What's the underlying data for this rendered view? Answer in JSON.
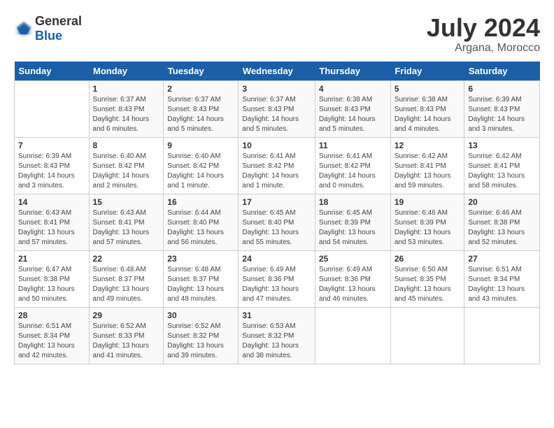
{
  "logo": {
    "text_general": "General",
    "text_blue": "Blue"
  },
  "title": {
    "month_year": "July 2024",
    "location": "Argana, Morocco"
  },
  "days_of_week": [
    "Sunday",
    "Monday",
    "Tuesday",
    "Wednesday",
    "Thursday",
    "Friday",
    "Saturday"
  ],
  "weeks": [
    [
      {
        "day": "",
        "sunrise": "",
        "sunset": "",
        "daylight": ""
      },
      {
        "day": "1",
        "sunrise": "Sunrise: 6:37 AM",
        "sunset": "Sunset: 8:43 PM",
        "daylight": "Daylight: 14 hours and 6 minutes."
      },
      {
        "day": "2",
        "sunrise": "Sunrise: 6:37 AM",
        "sunset": "Sunset: 8:43 PM",
        "daylight": "Daylight: 14 hours and 5 minutes."
      },
      {
        "day": "3",
        "sunrise": "Sunrise: 6:37 AM",
        "sunset": "Sunset: 8:43 PM",
        "daylight": "Daylight: 14 hours and 5 minutes."
      },
      {
        "day": "4",
        "sunrise": "Sunrise: 6:38 AM",
        "sunset": "Sunset: 8:43 PM",
        "daylight": "Daylight: 14 hours and 5 minutes."
      },
      {
        "day": "5",
        "sunrise": "Sunrise: 6:38 AM",
        "sunset": "Sunset: 8:43 PM",
        "daylight": "Daylight: 14 hours and 4 minutes."
      },
      {
        "day": "6",
        "sunrise": "Sunrise: 6:39 AM",
        "sunset": "Sunset: 8:43 PM",
        "daylight": "Daylight: 14 hours and 3 minutes."
      }
    ],
    [
      {
        "day": "7",
        "sunrise": "Sunrise: 6:39 AM",
        "sunset": "Sunset: 8:43 PM",
        "daylight": "Daylight: 14 hours and 3 minutes."
      },
      {
        "day": "8",
        "sunrise": "Sunrise: 6:40 AM",
        "sunset": "Sunset: 8:42 PM",
        "daylight": "Daylight: 14 hours and 2 minutes."
      },
      {
        "day": "9",
        "sunrise": "Sunrise: 6:40 AM",
        "sunset": "Sunset: 8:42 PM",
        "daylight": "Daylight: 14 hours and 1 minute."
      },
      {
        "day": "10",
        "sunrise": "Sunrise: 6:41 AM",
        "sunset": "Sunset: 8:42 PM",
        "daylight": "Daylight: 14 hours and 1 minute."
      },
      {
        "day": "11",
        "sunrise": "Sunrise: 6:41 AM",
        "sunset": "Sunset: 8:42 PM",
        "daylight": "Daylight: 14 hours and 0 minutes."
      },
      {
        "day": "12",
        "sunrise": "Sunrise: 6:42 AM",
        "sunset": "Sunset: 8:41 PM",
        "daylight": "Daylight: 13 hours and 59 minutes."
      },
      {
        "day": "13",
        "sunrise": "Sunrise: 6:42 AM",
        "sunset": "Sunset: 8:41 PM",
        "daylight": "Daylight: 13 hours and 58 minutes."
      }
    ],
    [
      {
        "day": "14",
        "sunrise": "Sunrise: 6:43 AM",
        "sunset": "Sunset: 8:41 PM",
        "daylight": "Daylight: 13 hours and 57 minutes."
      },
      {
        "day": "15",
        "sunrise": "Sunrise: 6:43 AM",
        "sunset": "Sunset: 8:41 PM",
        "daylight": "Daylight: 13 hours and 57 minutes."
      },
      {
        "day": "16",
        "sunrise": "Sunrise: 6:44 AM",
        "sunset": "Sunset: 8:40 PM",
        "daylight": "Daylight: 13 hours and 56 minutes."
      },
      {
        "day": "17",
        "sunrise": "Sunrise: 6:45 AM",
        "sunset": "Sunset: 8:40 PM",
        "daylight": "Daylight: 13 hours and 55 minutes."
      },
      {
        "day": "18",
        "sunrise": "Sunrise: 6:45 AM",
        "sunset": "Sunset: 8:39 PM",
        "daylight": "Daylight: 13 hours and 54 minutes."
      },
      {
        "day": "19",
        "sunrise": "Sunrise: 6:46 AM",
        "sunset": "Sunset: 8:39 PM",
        "daylight": "Daylight: 13 hours and 53 minutes."
      },
      {
        "day": "20",
        "sunrise": "Sunrise: 6:46 AM",
        "sunset": "Sunset: 8:38 PM",
        "daylight": "Daylight: 13 hours and 52 minutes."
      }
    ],
    [
      {
        "day": "21",
        "sunrise": "Sunrise: 6:47 AM",
        "sunset": "Sunset: 8:38 PM",
        "daylight": "Daylight: 13 hours and 50 minutes."
      },
      {
        "day": "22",
        "sunrise": "Sunrise: 6:48 AM",
        "sunset": "Sunset: 8:37 PM",
        "daylight": "Daylight: 13 hours and 49 minutes."
      },
      {
        "day": "23",
        "sunrise": "Sunrise: 6:48 AM",
        "sunset": "Sunset: 8:37 PM",
        "daylight": "Daylight: 13 hours and 48 minutes."
      },
      {
        "day": "24",
        "sunrise": "Sunrise: 6:49 AM",
        "sunset": "Sunset: 8:36 PM",
        "daylight": "Daylight: 13 hours and 47 minutes."
      },
      {
        "day": "25",
        "sunrise": "Sunrise: 6:49 AM",
        "sunset": "Sunset: 8:36 PM",
        "daylight": "Daylight: 13 hours and 46 minutes."
      },
      {
        "day": "26",
        "sunrise": "Sunrise: 6:50 AM",
        "sunset": "Sunset: 8:35 PM",
        "daylight": "Daylight: 13 hours and 45 minutes."
      },
      {
        "day": "27",
        "sunrise": "Sunrise: 6:51 AM",
        "sunset": "Sunset: 8:34 PM",
        "daylight": "Daylight: 13 hours and 43 minutes."
      }
    ],
    [
      {
        "day": "28",
        "sunrise": "Sunrise: 6:51 AM",
        "sunset": "Sunset: 8:34 PM",
        "daylight": "Daylight: 13 hours and 42 minutes."
      },
      {
        "day": "29",
        "sunrise": "Sunrise: 6:52 AM",
        "sunset": "Sunset: 8:33 PM",
        "daylight": "Daylight: 13 hours and 41 minutes."
      },
      {
        "day": "30",
        "sunrise": "Sunrise: 6:52 AM",
        "sunset": "Sunset: 8:32 PM",
        "daylight": "Daylight: 13 hours and 39 minutes."
      },
      {
        "day": "31",
        "sunrise": "Sunrise: 6:53 AM",
        "sunset": "Sunset: 8:32 PM",
        "daylight": "Daylight: 13 hours and 38 minutes."
      },
      {
        "day": "",
        "sunrise": "",
        "sunset": "",
        "daylight": ""
      },
      {
        "day": "",
        "sunrise": "",
        "sunset": "",
        "daylight": ""
      },
      {
        "day": "",
        "sunrise": "",
        "sunset": "",
        "daylight": ""
      }
    ]
  ]
}
